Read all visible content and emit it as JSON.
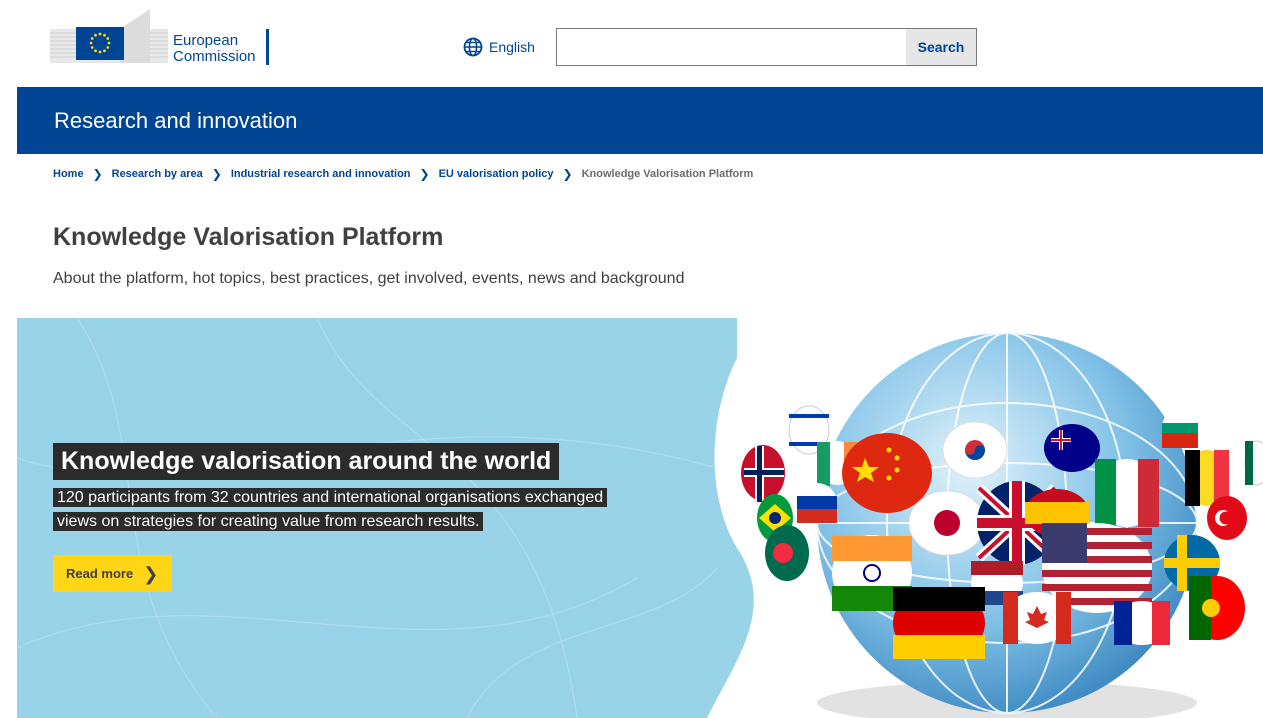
{
  "header": {
    "logo_text_line1": "European",
    "logo_text_line2": "Commission",
    "language_label": "English",
    "language_icon": "globe-icon",
    "search": {
      "placeholder": "",
      "value": "",
      "button_label": "Search"
    }
  },
  "site": {
    "title": "Research and innovation"
  },
  "breadcrumb": [
    {
      "label": "Home"
    },
    {
      "label": "Research by area"
    },
    {
      "label": "Industrial research and innovation"
    },
    {
      "label": "EU valorisation policy"
    },
    {
      "label": "Knowledge Valorisation Platform"
    }
  ],
  "page": {
    "title": "Knowledge Valorisation Platform",
    "subtitle": "About the platform, hot topics, best practices, get involved, events, news and background"
  },
  "banner": {
    "title": "Knowledge valorisation around the world",
    "text_line1": "120 participants from 32 countries and international organisations exchanged",
    "text_line2": "views on strategies for creating value from research results.",
    "button_label": "Read more",
    "image": "globe-with-flag-speech-bubbles",
    "background_color": "#99d3e7"
  },
  "colors": {
    "brand_blue": "#004494",
    "accent_yellow": "#ffd617",
    "dark_label": "#2b2b2b"
  }
}
